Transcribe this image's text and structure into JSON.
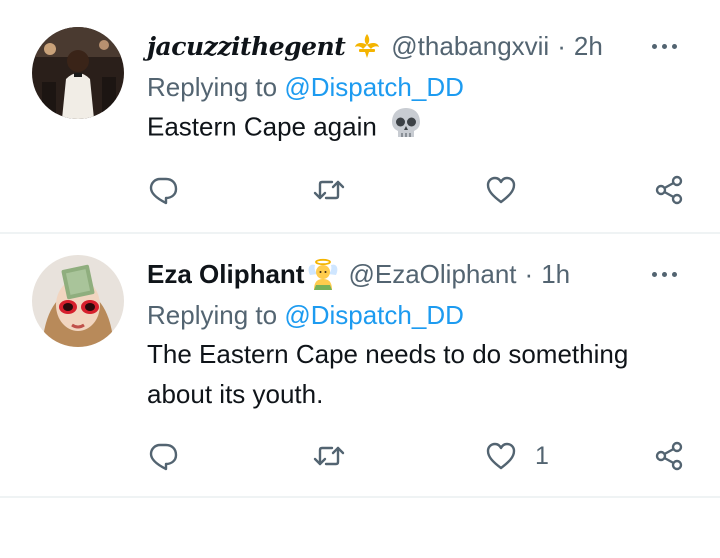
{
  "tweets": [
    {
      "name": "jacuzzithegent",
      "handle": "@thabangxvii",
      "separator": "·",
      "time": "2h",
      "replying_prefix": "Replying to",
      "replying_to": "@Dispatch_DD",
      "text": "Eastern Cape again",
      "badge_icon": "fleur-de-lis-icon",
      "text_emoji_icon": "skull-emoji-icon",
      "like_count": ""
    },
    {
      "name": "Eza Oliphant",
      "handle": "@EzaOliphant",
      "separator": "·",
      "time": "1h",
      "replying_prefix": "Replying to",
      "replying_to": "@Dispatch_DD",
      "text_line1": "The Eastern Cape needs to do something",
      "text_line2": "about its youth.",
      "badge_icon": "angel-emoji-icon",
      "like_count": "1"
    }
  ],
  "colors": {
    "link": "#1d9bf0",
    "secondary": "#536471",
    "divider": "#eff3f4"
  }
}
